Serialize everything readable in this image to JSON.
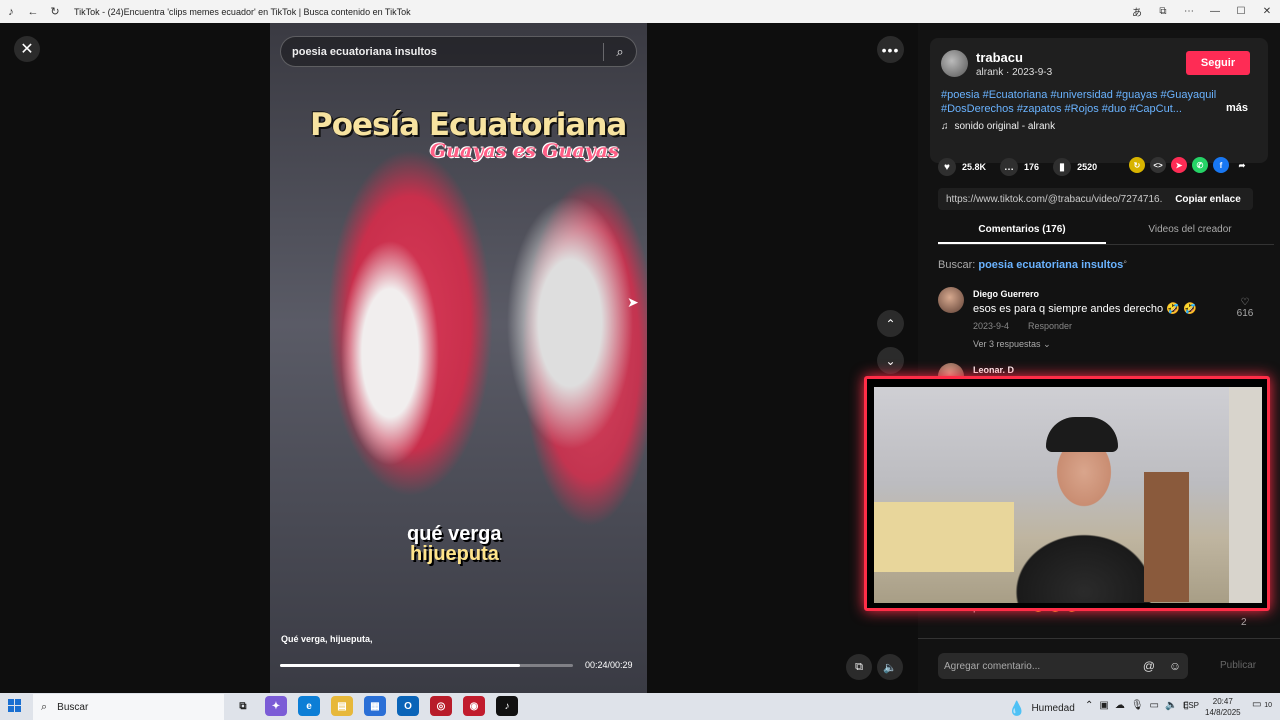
{
  "window": {
    "title": "TikTok - (24)Encuentra 'clips memes ecuador' en TikTok | Busca contenido en TikTok"
  },
  "video": {
    "search_query": "poesia ecuatoriana insultos",
    "headline": "Poesía Ecuatoriana",
    "subhead": "Guayas es Guayas",
    "caption_line1": "qué verga",
    "caption_line2": "hijueputa",
    "subtitle": "Qué verga, hijueputa,",
    "time": "00:24/00:29",
    "progress_fraction": 0.82
  },
  "creator": {
    "name": "trabacu",
    "meta": "alrank · 2023-9-3",
    "follow_label": "Seguir",
    "tags": "#poesia #Ecuatoriana #universidad #guayas #Guayaquil #DosDerechos #zapatos #Rojos #duo #CapCut...",
    "more_label": "más",
    "sound": "sonido original - alrank"
  },
  "stats": {
    "likes": "25.8K",
    "comments": "176",
    "saves": "2520"
  },
  "link": {
    "url": "https://www.tiktok.com/@trabacu/video/7274716...",
    "copy_label": "Copiar enlace"
  },
  "tabs": {
    "comments": "Comentarios (176)",
    "creator_videos": "Videos del creador"
  },
  "search_hint": {
    "prefix": "Buscar:",
    "query": "poesia ecuatoriana insultos"
  },
  "comments": [
    {
      "name": "Diego Guerrero",
      "text": "esos es para q siempre andes derecho 🤣 🤣",
      "date": "2023-9-4",
      "reply": "Responder",
      "likes": "616",
      "more_replies": "Ver 3 respuestas"
    },
    {
      "name": "Leonar. D"
    }
  ],
  "partial_comment": {
    "text": "por derecha😂 😂 😂",
    "likes": "2"
  },
  "comment_input": {
    "placeholder": "Agregar comentario...",
    "post_label": "Publicar"
  },
  "taskbar": {
    "search_placeholder": "Buscar",
    "weather": "Humedad",
    "lang": "ESP",
    "time": "20:47",
    "date": "14/8/2025",
    "notifications": "10"
  },
  "colors": {
    "accent": "#fe2c55",
    "link": "#6ab3ff",
    "webcam_border": "#ff2d47"
  }
}
